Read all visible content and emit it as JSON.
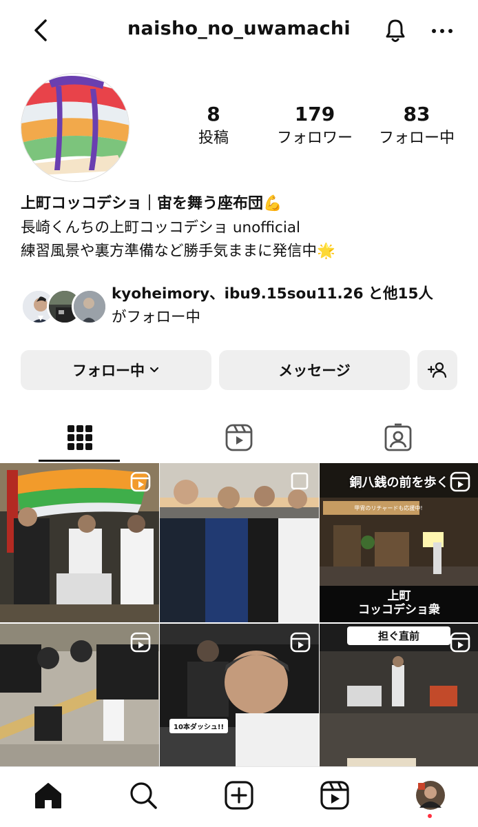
{
  "header": {
    "username": "naisho_no_uwamachi",
    "icons": [
      "back-icon",
      "bell-icon",
      "more-icon"
    ]
  },
  "profile": {
    "stats": [
      {
        "value": "8",
        "label": "投稿"
      },
      {
        "value": "179",
        "label": "フォロワー"
      },
      {
        "value": "83",
        "label": "フォロー中"
      }
    ],
    "name": "上町コッコデショ｜宙を舞う座布団💪",
    "bio": [
      "長崎くんちの上町コッコデショ unofficial",
      "練習風景や裏方準備など勝手気ままに発信中🌟"
    ],
    "followed_by": {
      "names": "kyoheimory、ibu9.15sou11.26",
      "rest": "と他15人",
      "suffix": "がフォロー中"
    }
  },
  "buttons": {
    "follow": "フォロー中",
    "message": "メッセージ",
    "add_user_icon": "add-person-icon"
  },
  "tabs": [
    "grid-icon",
    "reels-icon",
    "tagged-icon"
  ],
  "grid": {
    "posts": [
      {
        "type": "reel",
        "overlay": ""
      },
      {
        "type": "carousel",
        "overlay": ""
      },
      {
        "type": "reel",
        "overlay_top": "銅八銭の前を歩く",
        "overlay_sign": "甲冑のリチャードも応援中!",
        "overlay_bottom": "上町\nコッコデショ衆"
      },
      {
        "type": "reel",
        "overlay": ""
      },
      {
        "type": "reel",
        "overlay": "10本ダッシュ!!"
      },
      {
        "type": "reel",
        "overlay": "担ぐ直前"
      }
    ]
  },
  "nav": [
    "home-icon",
    "search-icon",
    "create-icon",
    "reels-icon",
    "profile-avatar"
  ],
  "colors": {
    "accent": "#111111",
    "button_bg": "#efefef",
    "notification_dot": "#ff3040"
  }
}
